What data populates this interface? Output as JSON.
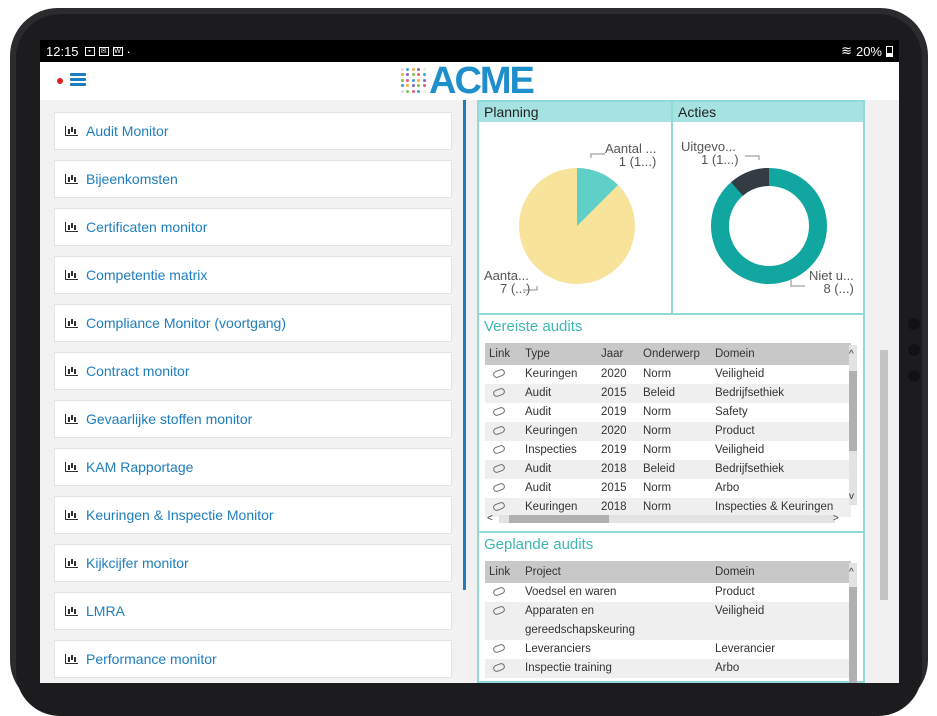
{
  "status": {
    "time": "12:15",
    "icons": [
      "photo-icon",
      "mail-icon",
      "w-icon"
    ],
    "extra": "·",
    "wifi": "wifi-icon",
    "battery": "20%"
  },
  "app": {
    "logo_text": "ACME",
    "logo_dot_colors": [
      "#e95c7b",
      "#f2b134",
      "#7cc35a",
      "#3aa0d8",
      "#8b5fbf"
    ]
  },
  "sidebar": {
    "items": [
      {
        "label": "Audit Monitor"
      },
      {
        "label": "Bijeenkomsten"
      },
      {
        "label": "Certificaten monitor"
      },
      {
        "label": "Competentie matrix"
      },
      {
        "label": "Compliance Monitor (voortgang)"
      },
      {
        "label": "Contract monitor"
      },
      {
        "label": "Gevaarlijke stoffen monitor"
      },
      {
        "label": "KAM Rapportage"
      },
      {
        "label": "Keuringen & Inspectie Monitor"
      },
      {
        "label": "Kijkcijfer monitor"
      },
      {
        "label": "LMRA"
      },
      {
        "label": "Performance monitor"
      }
    ]
  },
  "planning": {
    "title": "Planning",
    "label_a_name": "Aantal ...",
    "label_a_value": "1 (1...)",
    "label_b_name": "Aanta...",
    "label_b_value": "7 (...)",
    "colors": {
      "major": "#f8e39b",
      "minor": "#5fcfc8"
    }
  },
  "acties": {
    "title": "Acties",
    "label_a_name": "Uitgevo...",
    "label_a_value": "1 (1...)",
    "label_b_name": "Niet u...",
    "label_b_value": "8 (...)",
    "colors": {
      "major": "#11a69f",
      "minor": "#333c42"
    }
  },
  "vereiste": {
    "title": "Vereiste audits",
    "headers": [
      "Link",
      "Type",
      "Jaar",
      "Onderwerp",
      "Domein"
    ],
    "rows": [
      [
        "Keuringen",
        "2020",
        "Norm",
        "Veiligheid"
      ],
      [
        "Audit",
        "2015",
        "Beleid",
        "Bedrijfsethiek"
      ],
      [
        "Audit",
        "2019",
        "Norm",
        "Safety"
      ],
      [
        "Keuringen",
        "2020",
        "Norm",
        "Product"
      ],
      [
        "Inspecties",
        "2019",
        "Norm",
        "Veiligheid"
      ],
      [
        "Audit",
        "2018",
        "Beleid",
        "Bedrijfsethiek"
      ],
      [
        "Audit",
        "2015",
        "Norm",
        "Arbo"
      ],
      [
        "Keuringen",
        "2018",
        "Norm",
        "Inspecties & Keuringen"
      ]
    ]
  },
  "geplande": {
    "title": "Geplande audits",
    "headers": [
      "Link",
      "Project",
      "Domein"
    ],
    "rows": [
      [
        "Voedsel en waren",
        "",
        "Product"
      ],
      [
        "Apparaten en",
        "gereedschapskeuring",
        "Veiligheid"
      ],
      [
        "Leveranciers",
        "",
        "Leverancier"
      ],
      [
        "Inspectie training",
        "",
        "Arbo"
      ]
    ]
  }
}
